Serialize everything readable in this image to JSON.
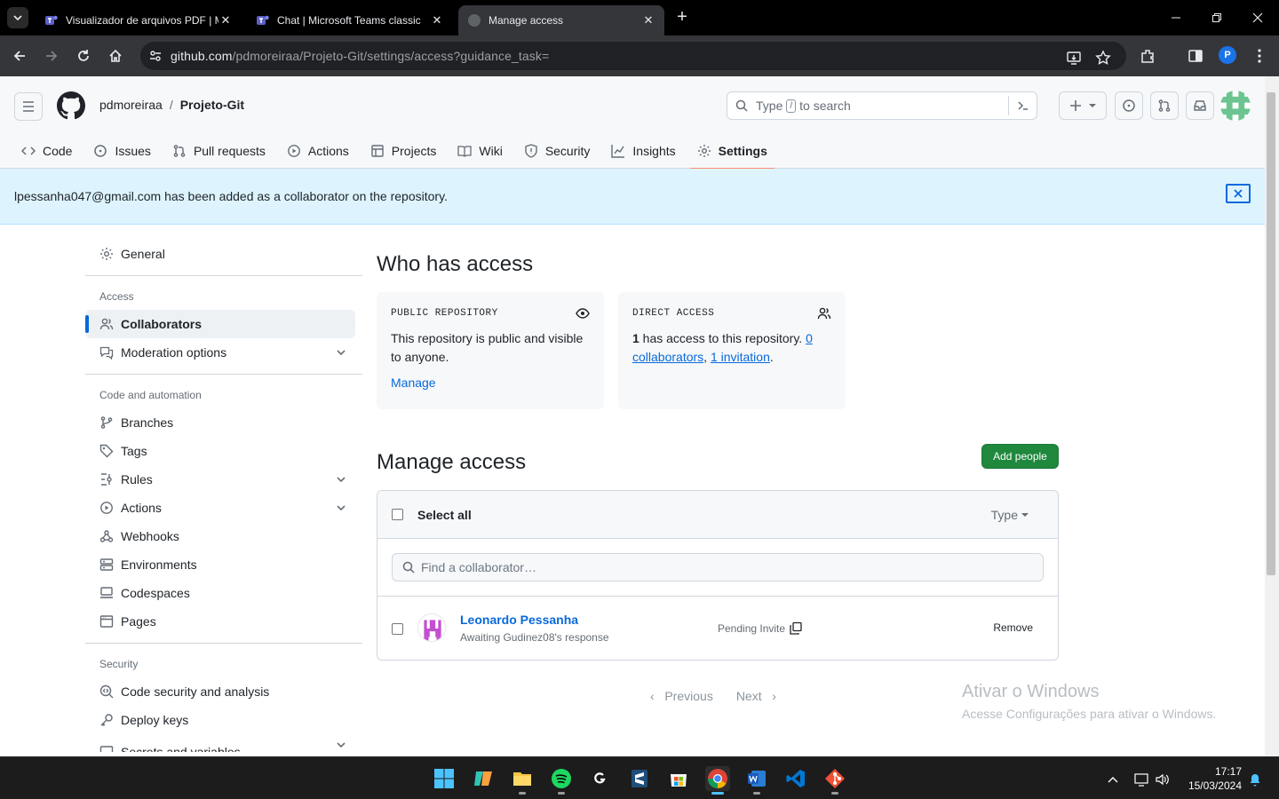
{
  "browser": {
    "tabs": [
      {
        "title": "Visualizador de arquivos PDF | M",
        "active": false
      },
      {
        "title": "Chat | Microsoft Teams classic",
        "active": false
      },
      {
        "title": "Manage access",
        "active": true
      }
    ],
    "url_host": "github.com",
    "url_path": "/pdmoreiraa/Projeto-Git/settings/access?guidance_task=",
    "profile_initial": "P"
  },
  "header": {
    "owner": "pdmoreiraa",
    "separator": "/",
    "repo": "Projeto-Git",
    "search_prefix": "Type",
    "search_key": "/",
    "search_suffix": "to search"
  },
  "repo_nav": [
    {
      "label": "Code",
      "icon": "code-icon"
    },
    {
      "label": "Issues",
      "icon": "issue-icon"
    },
    {
      "label": "Pull requests",
      "icon": "pull-request-icon"
    },
    {
      "label": "Actions",
      "icon": "play-icon"
    },
    {
      "label": "Projects",
      "icon": "table-icon"
    },
    {
      "label": "Wiki",
      "icon": "book-icon"
    },
    {
      "label": "Security",
      "icon": "shield-icon"
    },
    {
      "label": "Insights",
      "icon": "graph-icon"
    },
    {
      "label": "Settings",
      "icon": "gear-icon",
      "selected": true
    }
  ],
  "flash": {
    "message": "lpessanha047@gmail.com has been added as a collaborator on the repository."
  },
  "sidebar": {
    "general": "General",
    "access_heading": "Access",
    "collaborators": "Collaborators",
    "moderation": "Moderation options",
    "code_heading": "Code and automation",
    "branches": "Branches",
    "tags": "Tags",
    "rules": "Rules",
    "actions": "Actions",
    "webhooks": "Webhooks",
    "environments": "Environments",
    "codespaces": "Codespaces",
    "pages": "Pages",
    "security_heading": "Security",
    "code_security": "Code security and analysis",
    "deploy_keys": "Deploy keys",
    "secrets": "Secrets and variables"
  },
  "who_has_access": {
    "title": "Who has access",
    "public_label": "PUBLIC REPOSITORY",
    "public_text": "This repository is public and visible to anyone.",
    "manage": "Manage",
    "direct_label": "DIRECT ACCESS",
    "direct_count": "1",
    "direct_text": " has access to this repository. ",
    "collaborators_link": "0 collaborators",
    "invitation_link": "1 invitation"
  },
  "manage_access": {
    "title": "Manage access",
    "add_people": "Add people",
    "select_all": "Select all",
    "type_filter": "Type",
    "find_placeholder": "Find a collaborator…",
    "collaborators": [
      {
        "name": "Leonardo Pessanha",
        "status": "Awaiting Gudinez08's response",
        "pending": "Pending Invite",
        "remove": "Remove"
      }
    ],
    "previous": "Previous",
    "next": "Next"
  },
  "watermark": {
    "title": "Ativar o Windows",
    "subtitle": "Acesse Configurações para ativar o Windows."
  },
  "taskbar": {
    "time": "17:17",
    "date": "15/03/2024"
  }
}
